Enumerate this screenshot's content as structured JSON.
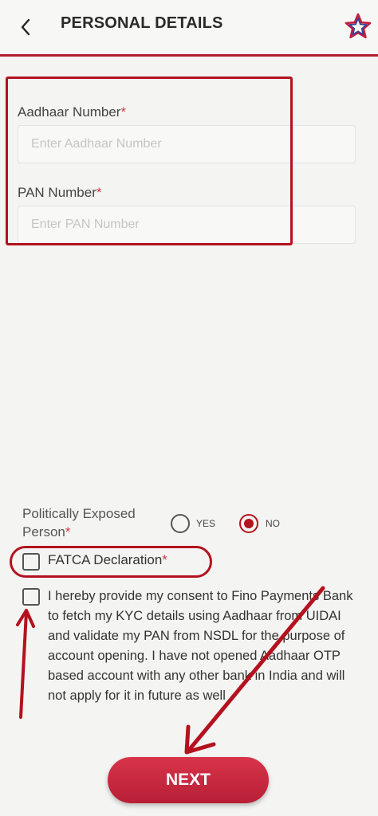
{
  "header": {
    "title": "PERSONAL DETAILS",
    "back_icon": "chevron-left-icon",
    "favorite_icon": "star-icon"
  },
  "form": {
    "aadhaar": {
      "label": "Aadhaar Number",
      "required": "*",
      "placeholder": "Enter Aadhaar Number",
      "value": ""
    },
    "pan": {
      "label": "PAN Number",
      "required": "*",
      "placeholder": "Enter PAN Number",
      "value": ""
    },
    "pep": {
      "label_line1": "Politically Exposed",
      "label_line2": "Person",
      "required": "*",
      "options": [
        "YES",
        "NO"
      ],
      "selected": "NO"
    },
    "fatca": {
      "label": "FATCA Declaration",
      "required": "*",
      "checked": false
    },
    "consent": {
      "text": "I hereby provide my consent to Fino Payments Bank to fetch my KYC details using Aadhaar from UIDAI and validate my PAN from NSDL for the purpose of account opening. I have not opened Aadhaar OTP based account with any other bank in India and will not apply for it in future as well",
      "checked": false
    }
  },
  "actions": {
    "next_label": "NEXT"
  },
  "colors": {
    "brand": "#b31e2e",
    "button": "#c92a40",
    "annotation": "#b3121e",
    "background": "#f4f4f2"
  }
}
